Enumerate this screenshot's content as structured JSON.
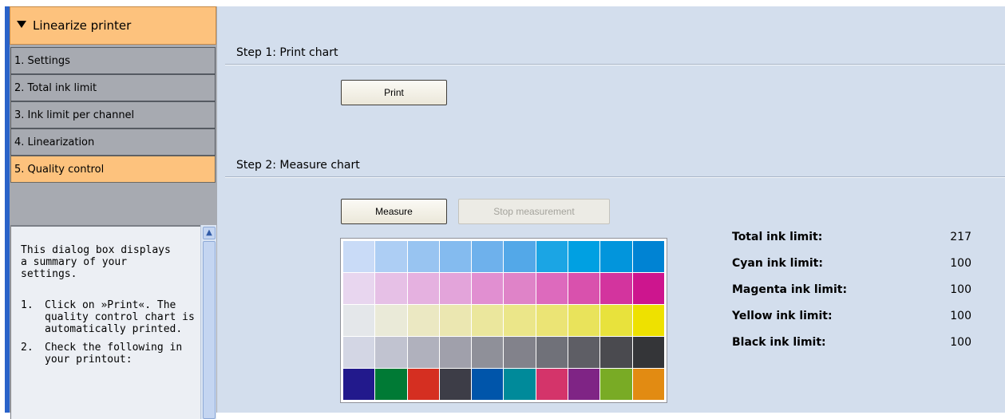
{
  "sidebar": {
    "header": "Linearize printer",
    "items": [
      {
        "label": "1. Settings",
        "active": false
      },
      {
        "label": "2. Total ink limit",
        "active": false
      },
      {
        "label": "3. Ink limit per channel",
        "active": false
      },
      {
        "label": "4. Linearization",
        "active": false
      },
      {
        "label": "5. Quality control",
        "active": true
      }
    ],
    "help": {
      "intro": "This dialog box displays a summary of your settings.",
      "steps": [
        {
          "num": "1.",
          "text": "Click on »Print«. The quality control chart is automatically printed."
        },
        {
          "num": "2.",
          "text": "Check the following in your printout:"
        }
      ]
    }
  },
  "main": {
    "step1": {
      "title": "Step 1: Print chart",
      "print_label": "Print"
    },
    "step2": {
      "title": "Step 2: Measure chart",
      "measure_label": "Measure",
      "stop_label": "Stop measurement"
    },
    "chart_patches": [
      [
        "#c9dbf7",
        "#adcef4",
        "#98c4f1",
        "#84bbef",
        "#6eb1ec",
        "#53a8e8",
        "#1ba5e4",
        "#00a0e2",
        "#0295dc",
        "#0083d3"
      ],
      [
        "#e8d6ef",
        "#e6c0e6",
        "#e5b1e0",
        "#e3a4da",
        "#e18fd1",
        "#df83c8",
        "#dd6abd",
        "#d951ad",
        "#d3349e",
        "#cd158e"
      ],
      [
        "#e4e7ea",
        "#eaead8",
        "#ebe8c2",
        "#ebe7b1",
        "#ebe79d",
        "#ebe689",
        "#ebe475",
        "#e9e35b",
        "#e8e23c",
        "#eee100"
      ],
      [
        "#d3d6e4",
        "#c1c3d0",
        "#b0b1bd",
        "#a0a0ab",
        "#8f9099",
        "#82828b",
        "#707179",
        "#5e5e65",
        "#4a4a4f",
        "#343538"
      ],
      [
        "#22198c",
        "#007a35",
        "#d52f21",
        "#3d3d47",
        "#0055aa",
        "#008a9a",
        "#d4346a",
        "#7f2485",
        "#79ab25",
        "#e28b12"
      ]
    ],
    "ink_limits": [
      {
        "label": "Total ink limit:",
        "value": "217"
      },
      {
        "label": "Cyan ink limit:",
        "value": "100"
      },
      {
        "label": "Magenta ink limit:",
        "value": "100"
      },
      {
        "label": "Yellow ink limit:",
        "value": "100"
      },
      {
        "label": "Black ink limit:",
        "value": "100"
      }
    ]
  },
  "colors": {
    "accent_orange": "#fdc27d",
    "sidebar_gray": "#a7aab1",
    "panel_blue": "#d3deed",
    "rail_blue": "#2a63c9"
  }
}
